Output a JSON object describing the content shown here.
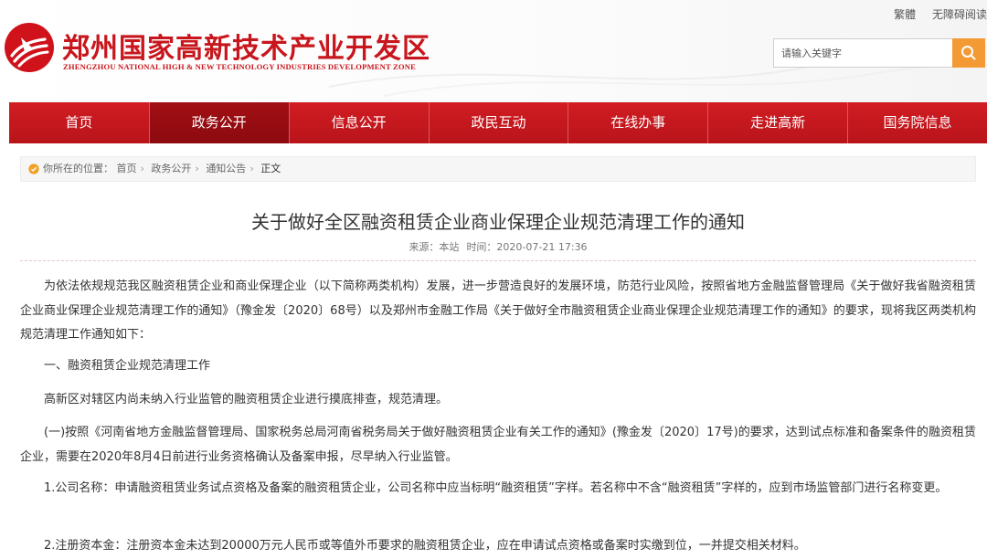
{
  "header": {
    "logo_cn": "郑州国家高新技术产业开发区",
    "logo_en": "ZHENGZHOU NATIONAL HIGH & NEW TECHNOLOGY INDUSTRIES DEVELOPMENT ZONE",
    "top_links": [
      "繁體",
      "无障碍阅读"
    ],
    "search_placeholder": "请输入关键字"
  },
  "nav": {
    "items": [
      {
        "label": "首页"
      },
      {
        "label": "政务公开",
        "active": true
      },
      {
        "label": "信息公开"
      },
      {
        "label": "政民互动"
      },
      {
        "label": "在线办事"
      },
      {
        "label": "走进高新"
      },
      {
        "label": "国务院信息"
      }
    ]
  },
  "breadcrumb": {
    "prefix": "你所在的位置：",
    "items": [
      "首页",
      "政务公开",
      "通知公告"
    ],
    "current": "正文"
  },
  "article": {
    "title": "关于做好全区融资租赁企业商业保理企业规范清理工作的通知",
    "source": "来源：本站",
    "time": "时间：2020-07-21 17:36",
    "paragraphs": [
      "为依法依规规范我区融资租赁企业和商业保理企业（以下简称两类机构）发展，进一步营造良好的发展环境，防范行业风险，按照省地方金融监督管理局《关于做好我省融资租赁企业商业保理企业规范清理工作的通知》（豫金发〔2020〕68号）以及郑州市金融工作局《关于做好全市融资租赁企业商业保理企业规范清理工作的通知》的要求，现将我区两类机构规范清理工作通知如下：",
      "一、融资租赁企业规范清理工作",
      "高新区对辖区内尚未纳入行业监管的融资租赁企业进行摸底排查，规范清理。",
      "(一)按照《河南省地方金融监督管理局、国家税务总局河南省税务局关于做好融资租赁企业有关工作的通知》(豫金发〔2020〕17号)的要求，达到试点标准和备案条件的融资租赁企业，需要在2020年8月4日前进行业务资格确认及备案申报，尽早纳入行业监管。",
      "1.公司名称：申请融资租赁业务试点资格及备案的融资租赁企业，公司名称中应当标明“融资租赁”字样。若名称中不含“融资租赁”字样的，应到市场监管部门进行名称变更。",
      "2.注册资本金：注册资本金未达到20000万元人民币或等值外币要求的融资租赁企业，应在申请试点资格或备案时实缴到位，一并提交相关材料。"
    ]
  }
}
